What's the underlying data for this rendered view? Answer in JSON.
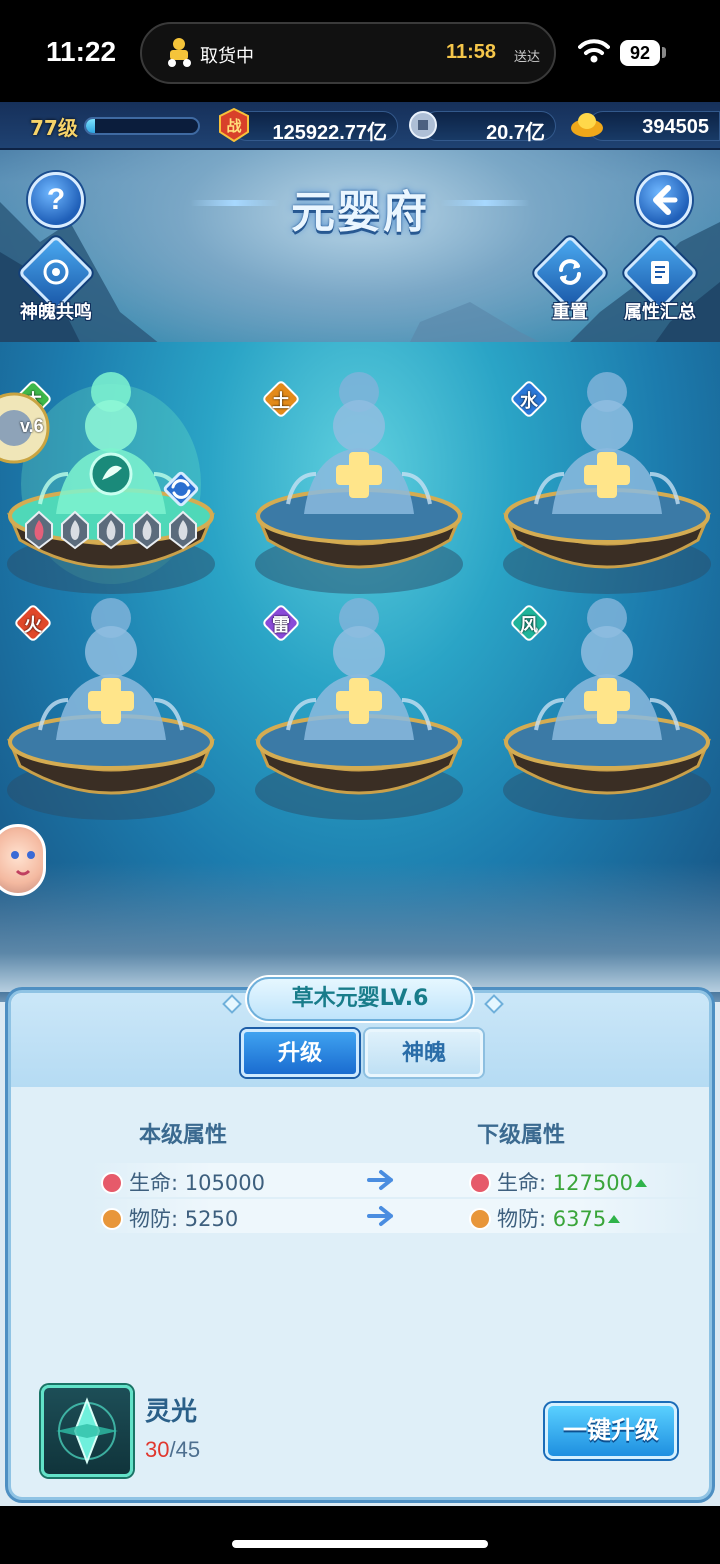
{
  "status_bar": {
    "time": "11:22",
    "activity_label": "取货中",
    "eta_time": "11:58",
    "eta_label": "送达",
    "battery": "92"
  },
  "resources": {
    "level": "77级",
    "xp_fraction": 0.08,
    "combat_power": "125922.77亿",
    "silver": "20.7亿",
    "gold": "394505"
  },
  "header": {
    "title": "元婴府",
    "help_label": "?",
    "resonance_label": "神魄共鸣",
    "reset_label": "重置",
    "summary_label": "属性汇总"
  },
  "slots": [
    {
      "element": "木",
      "color": "#3fb84a",
      "unlocked": true
    },
    {
      "element": "土",
      "color": "#e38a1a",
      "unlocked": false
    },
    {
      "element": "水",
      "color": "#2a78d8",
      "unlocked": false
    },
    {
      "element": "火",
      "color": "#e0482a",
      "unlocked": false
    },
    {
      "element": "雷",
      "color": "#8a4ad8",
      "unlocked": false
    },
    {
      "element": "风",
      "color": "#1fb39a",
      "unlocked": false
    }
  ],
  "side": {
    "level_text": "v.6"
  },
  "panel": {
    "name": "草木元婴LV.6",
    "tabs": [
      "升级",
      "神魄"
    ],
    "current_header": "本级属性",
    "next_header": "下级属性",
    "rows": [
      {
        "label": "生命:",
        "current": "105000",
        "next": "127500",
        "icon_color": "#e65a6a"
      },
      {
        "label": "物防:",
        "current": "5250",
        "next": "6375",
        "icon_color": "#e8963a"
      }
    ],
    "item_name": "灵光",
    "item_have": "30",
    "item_need": "/45",
    "upgrade_label": "一键升级"
  }
}
